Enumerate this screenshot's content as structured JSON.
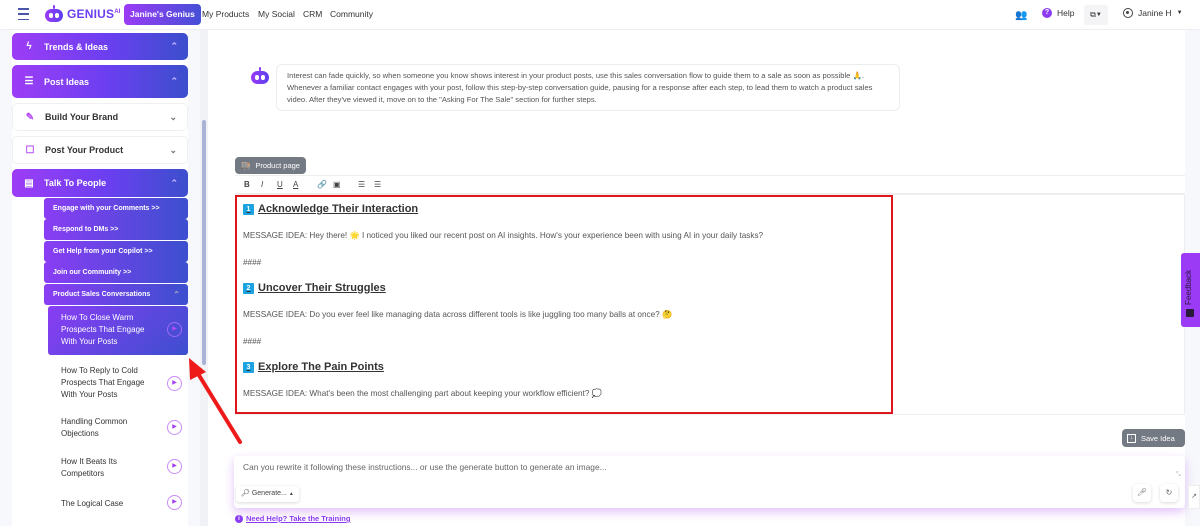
{
  "topbar": {
    "logo_text": "GENIUS",
    "logo_sup": "AI",
    "active_nav": "Janine's Genius",
    "nav_links": [
      "My Products",
      "My Social",
      "CRM",
      "Community"
    ],
    "help_label": "Help",
    "help_icon_glyph": "?",
    "user_name": "Janine H",
    "icons": {
      "menu": "hamburger-icon",
      "team": "people-icon",
      "help": "help-icon",
      "language": "translate-icon",
      "user": "user-circle-icon"
    }
  },
  "sidebar": {
    "sections": [
      {
        "label": "Trends & Ideas",
        "icon": "bolt-icon",
        "style": "gradient",
        "expanded": true
      },
      {
        "label": "Post Ideas",
        "icon": "list-icon",
        "style": "gradient",
        "expanded": true
      },
      {
        "label": "Build Your Brand",
        "icon": "pencil-icon",
        "style": "plain",
        "expanded": false
      },
      {
        "label": "Post Your Product",
        "icon": "bookmark-icon",
        "style": "plain",
        "expanded": false
      },
      {
        "label": "Talk To People",
        "icon": "chat-icon",
        "style": "gradient",
        "expanded": true
      }
    ],
    "sub_items": [
      "Engage with your Comments >>",
      "Respond to DMs >>",
      "Get Help from your Copilot >>",
      "Join our Community >>",
      "Product Sales Conversations"
    ],
    "lessons": [
      {
        "label": "How To Close Warm Prospects That Engage With Your Posts",
        "active": true
      },
      {
        "label": "How To Reply to Cold Prospects That Engage With Your Posts",
        "active": false
      },
      {
        "label": "Handling Common Objections",
        "active": false
      },
      {
        "label": "How It Beats Its Competitors",
        "active": false
      },
      {
        "label": "The Logical Case",
        "active": false
      }
    ]
  },
  "main": {
    "intro_text": "Interest can fade quickly, so when someone you know shows interest in your product posts, use this sales conversation flow to guide them to a sale as soon as possible 🙏. Whenever a familiar contact engages with your post, follow this step-by-step conversation guide, pausing for a response after each step, to lead them to watch a product sales video. After they've viewed it, move on to the \"Asking For The Sale\" section for further steps.",
    "tag_button": "Product page",
    "toolbar": [
      "B",
      "I",
      "U",
      "A",
      "link",
      "image",
      "ordered-list",
      "bullet-list"
    ],
    "editor": {
      "steps": [
        {
          "num": "1",
          "heading": "Acknowledge Their Interaction",
          "message": "MESSAGE IDEA: Hey there! 🌟 I noticed you liked our recent post on AI insights. How's your experience been with using AI in your daily tasks?"
        },
        {
          "num": "2",
          "heading": "Uncover Their Struggles",
          "message": "MESSAGE IDEA: Do you ever feel like managing data across different tools is like juggling too many balls at once? 🤔"
        },
        {
          "num": "3",
          "heading": "Explore The Pain Points",
          "message": "MESSAGE IDEA: What's been the most challenging part about keeping your workflow efficient? 💭"
        }
      ],
      "separator": "####"
    },
    "save_idea": "Save Idea",
    "prompt_placeholder": "Can you rewrite it following these instructions... or use the generate button to generate an image...",
    "generate_label": "Generate...",
    "help_link": "Need Help? Take the Training",
    "feedback_label": "Feedback"
  },
  "colors": {
    "brand_purple": "#9b3bf5",
    "brand_blue": "#3c4fcf",
    "highlight_red": "#e0161f",
    "step_badge": "#1aa3e0"
  }
}
